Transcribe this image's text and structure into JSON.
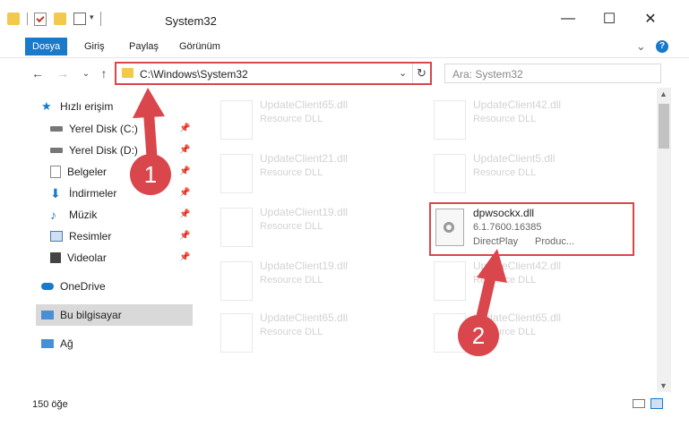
{
  "window": {
    "title": "System32",
    "minimize": "—",
    "maximize": "☐",
    "close": "✕"
  },
  "ribbon": {
    "tabs": [
      "Dosya",
      "Giriş",
      "Paylaş",
      "Görünüm"
    ],
    "expand": "⌄",
    "help": "?"
  },
  "address": {
    "back": "←",
    "forward": "→",
    "recent": "⌄",
    "up": "↑",
    "path": "C:\\Windows\\System32",
    "dropdown": "⌄",
    "refresh": "↻"
  },
  "search": {
    "placeholder": "Ara: System32"
  },
  "nav": {
    "quick_access": "Hızlı erişim",
    "items": [
      "Yerel Disk (C:)",
      "Yerel Disk (D:)",
      "Belgeler",
      "İndirmeler",
      "Müzik",
      "Resimler",
      "Videolar"
    ],
    "onedrive": "OneDrive",
    "this_pc": "Bu bilgisayar",
    "network": "Ağ",
    "pin": "📌"
  },
  "files": {
    "col1": [
      {
        "name": "UpdateClient65.dll",
        "sub": "Resource DLL"
      },
      {
        "name": "UpdateClient21.dll",
        "sub": "Resource DLL"
      },
      {
        "name": "UpdateClient19.dll",
        "sub": "Resource DLL"
      },
      {
        "name": "UpdateClient19.dll",
        "sub": "Resource DLL"
      },
      {
        "name": "UpdateClient65.dll",
        "sub": "Resource DLL"
      }
    ],
    "col2": [
      {
        "name": "UpdateClient42.dll",
        "sub": "Resource DLL"
      },
      {
        "name": "UpdateClient5.dll",
        "sub": "Resource DLL"
      },
      {
        "name": "UpdateClient42.dll",
        "sub": "Resource DLL"
      },
      {
        "name": "UpdateClient65.dll",
        "sub": "Resource DLL"
      }
    ],
    "highlighted": {
      "name": "dpwsockx.dll",
      "version": "6.1.7600.16385",
      "company": "DirectPlay",
      "product": "Produc..."
    }
  },
  "status": {
    "count": "150 öğe"
  },
  "badges": [
    "1",
    "2"
  ],
  "colors": {
    "accent": "#1979ca",
    "highlight": "#d9464c"
  }
}
